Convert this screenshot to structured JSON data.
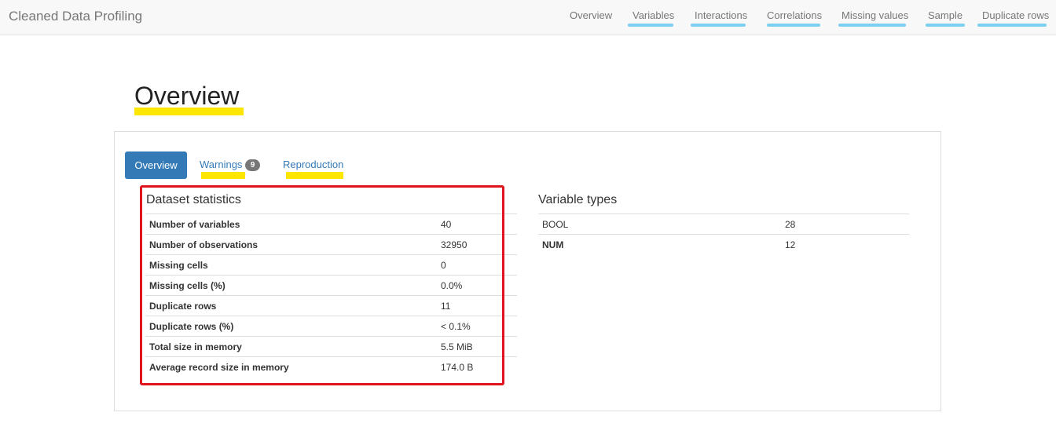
{
  "navbar": {
    "brand": "Cleaned Data Profiling",
    "links": [
      {
        "label": "Overview"
      },
      {
        "label": "Variables"
      },
      {
        "label": "Interactions"
      },
      {
        "label": "Correlations"
      },
      {
        "label": "Missing values"
      },
      {
        "label": "Sample"
      },
      {
        "label": "Duplicate rows"
      }
    ]
  },
  "page": {
    "title": "Overview"
  },
  "tabs": {
    "overview": "Overview",
    "warnings": "Warnings",
    "warnings_count": "9",
    "reproduction": "Reproduction"
  },
  "dataset_statistics": {
    "title": "Dataset statistics",
    "rows": [
      {
        "label": "Number of variables",
        "value": "40"
      },
      {
        "label": "Number of observations",
        "value": "32950"
      },
      {
        "label": "Missing cells",
        "value": "0"
      },
      {
        "label": "Missing cells (%)",
        "value": "0.0%"
      },
      {
        "label": "Duplicate rows",
        "value": "11"
      },
      {
        "label": "Duplicate rows (%)",
        "value": "< 0.1%"
      },
      {
        "label": "Total size in memory",
        "value": "5.5 MiB"
      },
      {
        "label": "Average record size in memory",
        "value": "174.0 B"
      }
    ]
  },
  "variable_types": {
    "title": "Variable types",
    "rows": [
      {
        "label": "BOOL",
        "value": "28"
      },
      {
        "label": "NUM",
        "value": "12"
      }
    ]
  },
  "colors": {
    "tab_active": "#337ab7",
    "link": "#337ab7",
    "highlight_yellow": "#ffe600",
    "highlight_blue": "#7ccff0",
    "highlight_red": "#e0141e"
  }
}
